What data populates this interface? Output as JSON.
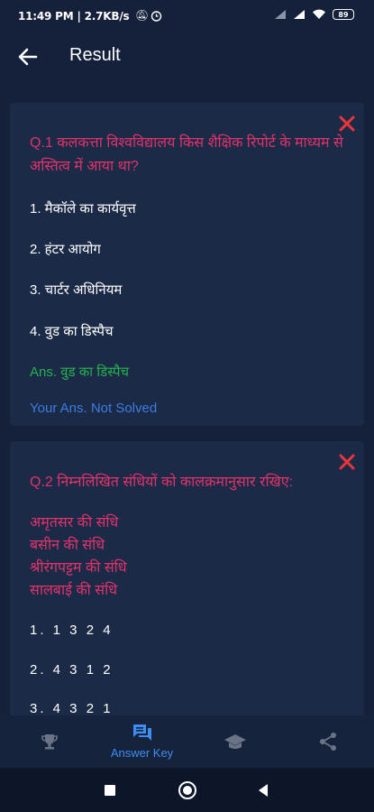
{
  "status_bar": {
    "time": "11:49 PM | 2.7KB/s",
    "battery": "89"
  },
  "app_bar": {
    "title": "Result"
  },
  "questions": [
    {
      "question": "Q.1  कलकत्ता विश्वविद्यालय किस शैक्षिक रिपोर्ट के माध्यम से अस्तित्व में आया था?",
      "options": [
        "1. मैकॉले का कार्यवृत्त",
        "2. हंटर आयोग",
        "3. चार्टर अधिनियम",
        "4. वुड का डिस्पैच"
      ],
      "answer": "Ans. वुड का डिस्पैच",
      "your_answer": "Your Ans. Not Solved"
    },
    {
      "question": "Q.2  निम्नलिखित संधियों को कालक्रमानुसार रखिए:",
      "statements": [
        "अमृतसर की संधि",
        "बसीन की संधि",
        "श्रीरंगपट्टम की संधि",
        "सालबाई की संधि"
      ],
      "options": [
        "1. 1 3 2 4",
        "2. 4 3 1 2",
        "3. 4 3 2 1"
      ]
    }
  ],
  "bottom_nav": {
    "answer_key_label": "Answer Key"
  },
  "colors": {
    "question": "#e0336a",
    "correct": "#27b24f",
    "your_answer": "#3b7de0",
    "close": "#e8363a",
    "accent": "#3e8df0"
  }
}
